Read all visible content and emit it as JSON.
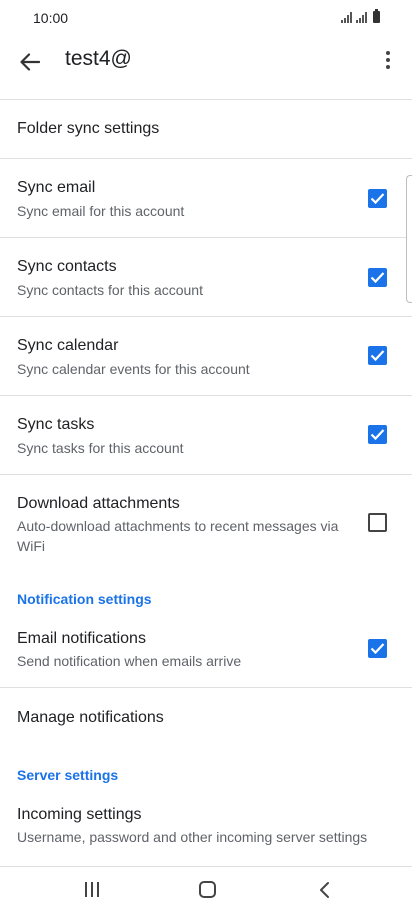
{
  "status_bar": {
    "time": "10:00"
  },
  "app_bar": {
    "title": "test4@",
    "back_icon": "arrow-back-icon",
    "more_icon": "more-vert-icon"
  },
  "folder_sync": {
    "label": "Folder sync settings"
  },
  "sync_items": [
    {
      "title": "Sync email",
      "subtitle": "Sync email for this account",
      "checked": true
    },
    {
      "title": "Sync contacts",
      "subtitle": "Sync contacts for this account",
      "checked": true
    },
    {
      "title": "Sync calendar",
      "subtitle": "Sync calendar events for this account",
      "checked": true
    },
    {
      "title": "Sync tasks",
      "subtitle": "Sync tasks for this account",
      "checked": true
    },
    {
      "title": "Download attachments",
      "subtitle": "Auto-download attachments to recent messages via WiFi",
      "checked": false
    }
  ],
  "notification_section": {
    "header": "Notification settings",
    "email_notifications": {
      "title": "Email notifications",
      "subtitle": "Send notification when emails arrive",
      "checked": true
    },
    "manage_label": "Manage notifications"
  },
  "server_section": {
    "header": "Server settings",
    "incoming": {
      "title": "Incoming settings",
      "subtitle": "Username, password and other incoming server settings"
    }
  },
  "colors": {
    "accent": "#1a73e8",
    "divider": "#e0e0e0",
    "secondary_text": "#5f6368"
  },
  "nav_bar": {
    "recents_icon": "recents-icon",
    "home_icon": "home-icon",
    "back_icon": "nav-back-icon"
  }
}
